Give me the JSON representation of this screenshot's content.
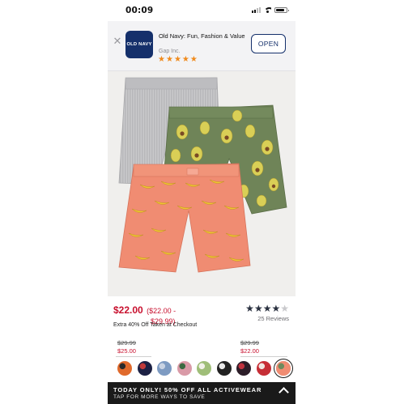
{
  "status_bar": {
    "time": "00:09",
    "battery_level": 0.8
  },
  "app_banner": {
    "icon_text": "OLD NAVY",
    "title": "Old Navy: Fun, Fashion & Value",
    "developer": "Gap Inc.",
    "rating_stars": 5,
    "open_label": "OPEN"
  },
  "product": {
    "image_name": "three-pack-boxer-shorts-photo",
    "price": "$22.00",
    "price_range_line1": "($22.00 -",
    "price_range_line2": "$29.99)",
    "promo": "Extra 40% Off Taken at Checkout",
    "rating": 4,
    "rating_max": 5,
    "reviews": "25 Reviews",
    "variants": [
      {
        "old_price": "$29.99",
        "new_price": "$25.00"
      },
      {
        "old_price": "$29.99",
        "new_price": "$22.00"
      }
    ]
  },
  "swatches": [
    {
      "name": "orange-print",
      "colors": [
        "#e06a2c",
        "#2a2a2a"
      ]
    },
    {
      "name": "navy-print",
      "colors": [
        "#1c2144",
        "#c03a3a"
      ]
    },
    {
      "name": "blue-plaid",
      "colors": [
        "#7e9bc2",
        "#c9d3e3"
      ]
    },
    {
      "name": "pink-print",
      "colors": [
        "#d99aa7",
        "#3b6a42"
      ]
    },
    {
      "name": "green-print",
      "colors": [
        "#9fbe78",
        "#f1f1e8"
      ]
    },
    {
      "name": "black-white",
      "colors": [
        "#222222",
        "#e8e8e8"
      ]
    },
    {
      "name": "dark-floral",
      "colors": [
        "#2c1d28",
        "#c0323f"
      ]
    },
    {
      "name": "red-white",
      "colors": [
        "#c62e36",
        "#f0e6e0"
      ]
    },
    {
      "name": "coral-banana",
      "colors": [
        "#f08c72",
        "#6e8a5e"
      ],
      "selected": true
    }
  ],
  "bottom_promo": {
    "line1": "TODAY ONLY! 50% OFF ALL ACTIVEWEAR",
    "line2": "TAP FOR MORE WAYS TO SAVE"
  },
  "colors": {
    "brand_navy": "#15306b",
    "sale_red": "#c8102e",
    "star_orange": "#f08a1c",
    "dark_star": "#2a3140"
  }
}
